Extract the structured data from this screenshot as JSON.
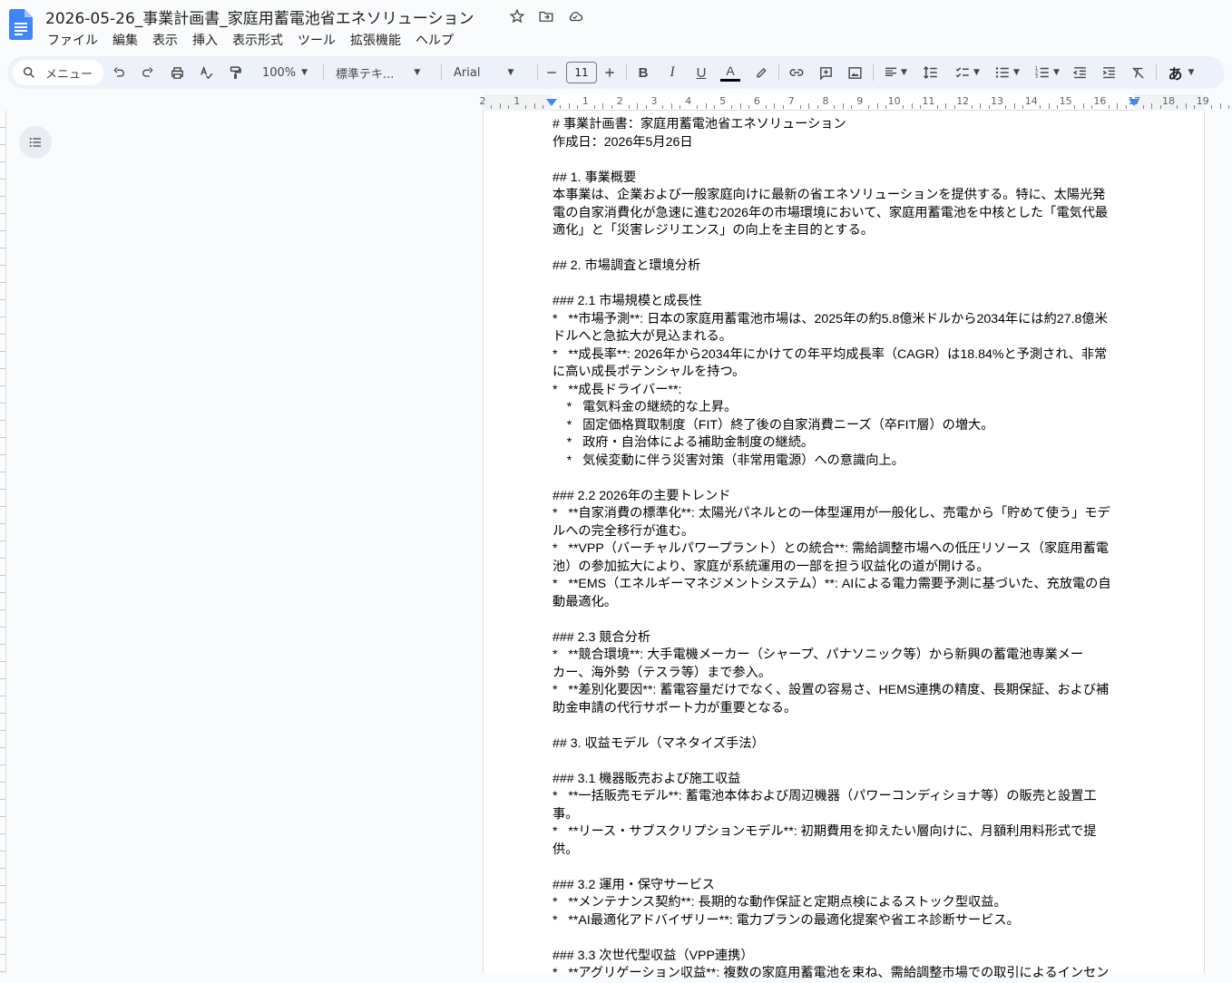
{
  "doc": {
    "title": "2026-05-26_事業計画書_家庭用蓄電池省エネソリューション"
  },
  "menu": [
    "ファイル",
    "編集",
    "表示",
    "挿入",
    "表示形式",
    "ツール",
    "拡張機能",
    "ヘルプ"
  ],
  "toolbar": {
    "search_label": "メニュー",
    "zoom": "100%",
    "style": "標準テキ...",
    "font": "Arial",
    "font_size": "11",
    "input_mode": "あ"
  },
  "ruler": {
    "labels": [
      "2",
      "1",
      "",
      "1",
      "2",
      "3",
      "4",
      "5",
      "6",
      "7",
      "8",
      "9",
      "10",
      "11",
      "12",
      "13",
      "14",
      "15",
      "16",
      "17",
      "18",
      "19"
    ]
  },
  "content_lines": [
    "# 事業計画書：家庭用蓄電池省エネソリューション",
    "作成日：2026年5月26日",
    "",
    "## 1. 事業概要",
    "本事業は、企業および一般家庭向けに最新の省エネソリューションを提供する。特に、太陽光発",
    "電の自家消費化が急速に進む2026年の市場環境において、家庭用蓄電池を中核とした「電気代最",
    "適化」と「災害レジリエンス」の向上を主目的とする。",
    "",
    "## 2. 市場調査と環境分析",
    "",
    "### 2.1 市場規模と成長性",
    "*   **市場予測**: 日本の家庭用蓄電池市場は、2025年の約5.8億米ドルから2034年には約27.8億米",
    "ドルへと急拡大が見込まれる。",
    "*   **成長率**: 2026年から2034年にかけての年平均成長率（CAGR）は18.84%と予測され、非常",
    "に高い成長ポテンシャルを持つ。",
    "*   **成長ドライバー**:",
    "    *   電気料金の継続的な上昇。",
    "    *   固定価格買取制度（FIT）終了後の自家消費ニーズ（卒FIT層）の増大。",
    "    *   政府・自治体による補助金制度の継続。",
    "    *   気候変動に伴う災害対策（非常用電源）への意識向上。",
    "",
    "### 2.2 2026年の主要トレンド",
    "*   **自家消費の標準化**: 太陽光パネルとの一体型運用が一般化し、売電から「貯めて使う」モデ",
    "ルへの完全移行が進む。",
    "*   **VPP（バーチャルパワープラント）との統合**: 需給調整市場への低圧リソース（家庭用蓄電",
    "池）の参加拡大により、家庭が系統運用の一部を担う収益化の道が開ける。",
    "*   **EMS（エネルギーマネジメントシステム）**: AIによる電力需要予測に基づいた、充放電の自",
    "動最適化。",
    "",
    "### 2.3 競合分析",
    "*   **競合環境**: 大手電機メーカー（シャープ、パナソニック等）から新興の蓄電池専業メー",
    "カー、海外勢（テスラ等）まで参入。",
    "*   **差別化要因**: 蓄電容量だけでなく、設置の容易さ、HEMS連携の精度、長期保証、および補",
    "助金申請の代行サポート力が重要となる。",
    "",
    "## 3. 収益モデル（マネタイズ手法）",
    "",
    "### 3.1 機器販売および施工収益",
    "*   **一括販売モデル**: 蓄電池本体および周辺機器（パワーコンディショナ等）の販売と設置工",
    "事。",
    "*   **リース・サブスクリプションモデル**: 初期費用を抑えたい層向けに、月額利用料形式で提",
    "供。",
    "",
    "### 3.2 運用・保守サービス",
    "*   **メンテナンス契約**: 長期的な動作保証と定期点検によるストック型収益。",
    "*   **AI最適化アドバイザリー**: 電力プランの最適化提案や省エネ診断サービス。",
    "",
    "### 3.3 次世代型収益（VPP連携）",
    "*   **アグリゲーション収益**: 複数の家庭用蓄電池を束ね、需給調整市場での取引によるインセン"
  ]
}
